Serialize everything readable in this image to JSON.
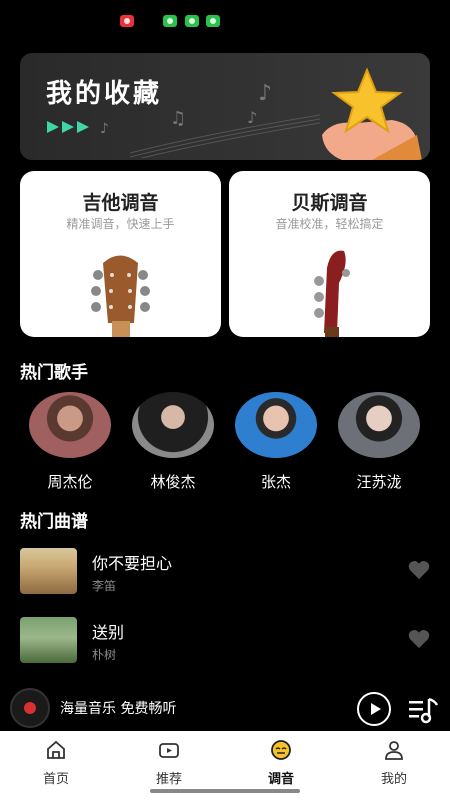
{
  "banner": {
    "title": "我的收藏"
  },
  "tuners": [
    {
      "title": "吉他调音",
      "subtitle": "精准调音，快速上手"
    },
    {
      "title": "贝斯调音",
      "subtitle": "音准校准，轻松搞定"
    }
  ],
  "artists_section": {
    "title": "热门歌手"
  },
  "artists": [
    {
      "name": "周杰伦"
    },
    {
      "name": "林俊杰"
    },
    {
      "name": "张杰"
    },
    {
      "name": "汪苏泷"
    }
  ],
  "songs_section": {
    "title": "热门曲谱"
  },
  "songs": [
    {
      "title": "你不要担心",
      "artist": "李笛"
    },
    {
      "title": "送别",
      "artist": "朴树"
    }
  ],
  "player": {
    "text": "海量音乐 免费畅听"
  },
  "nav": [
    {
      "label": "首页",
      "icon": "home-icon"
    },
    {
      "label": "推荐",
      "icon": "video-icon"
    },
    {
      "label": "调音",
      "icon": "tuner-face-icon",
      "active": true
    },
    {
      "label": "我的",
      "icon": "user-icon"
    }
  ],
  "colors": {
    "accent": "#3fd6a8",
    "star": "#f7c22b",
    "guitar_wood": "#9a5a2c",
    "bass_red": "#8b1e1e"
  }
}
